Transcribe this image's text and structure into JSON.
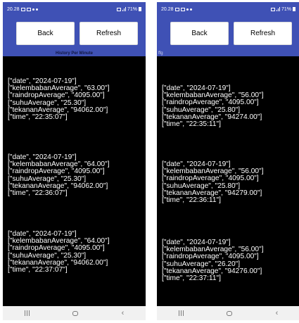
{
  "colors": {
    "app_bar": "#3f51b5",
    "content_bg": "#000000",
    "text": "#ffffff",
    "nav_bar": "#f1f1f1"
  },
  "icons": {
    "status_left": [
      "notification-icon",
      "notification-icon",
      "alarm-icon",
      "dot-icon"
    ],
    "status_right": [
      "vibrate-icon",
      "signal-icon",
      "battery-icon"
    ],
    "nav": [
      "recents-icon",
      "home-icon",
      "back-icon"
    ]
  },
  "screens": [
    {
      "status": {
        "time": "20.28",
        "battery": "71%"
      },
      "buttons": {
        "back": "Back",
        "refresh": "Refresh"
      },
      "caption": "History Per Minute",
      "records": [
        [
          "[\"date\", \"2024-07-19\"]",
          "[\"kelembabanAverage\", \"63.00\"]",
          "[\"raindropAverage\", \"4095.00\"]",
          "[\"suhuAverage\", \"25.30\"]",
          "[\"tekananAverage\", \"94062.00\"]",
          "[\"time\", \"22:35:07\"]"
        ],
        [
          "[\"date\", \"2024-07-19\"]",
          "[\"kelembabanAverage\", \"64.00\"]",
          "[\"raindropAverage\", \"4095.00\"]",
          "[\"suhuAverage\", \"25.30\"]",
          "[\"tekananAverage\", \"94062.00\"]",
          "[\"time\", \"22:36:07\"]"
        ],
        [
          "[\"date\", \"2024-07-19\"]",
          "[\"kelembabanAverage\", \"64.00\"]",
          "[\"raindropAverage\", \"4095.00\"]",
          "[\"suhuAverage\", \"25.30\"]",
          "[\"tekananAverage\", \"94062.00\"]",
          "[\"time\", \"22:37:07\"]"
        ]
      ]
    },
    {
      "status": {
        "time": "20.28",
        "battery": "71%"
      },
      "buttons": {
        "back": "Back",
        "refresh": "Refresh"
      },
      "caption": "ffg",
      "records": [
        [
          "[\"date\", \"2024-07-19\"]",
          "[\"kelembabanAverage\", \"56.00\"]",
          "[\"raindropAverage\", \"4095.00\"]",
          "[\"suhuAverage\", \"25.80\"]",
          "[\"tekananAverage\", \"94274.00\"]",
          "[\"time\", \"22:35:11\"]"
        ],
        [
          "[\"date\", \"2024-07-19\"]",
          "[\"kelembabanAverage\", \"56.00\"]",
          "[\"raindropAverage\", \"4095.00\"]",
          "[\"suhuAverage\", \"25.80\"]",
          "[\"tekananAverage\", \"94279.00\"]",
          "[\"time\", \"22:36:11\"]"
        ],
        [
          "[\"date\", \"2024-07-19\"]",
          "[\"kelembabanAverage\", \"56.00\"]",
          "[\"raindropAverage\", \"4095.00\"]",
          "[\"suhuAverage\", \"26.20\"]",
          "[\"tekananAverage\", \"94276.00\"]",
          "[\"time\", \"22:37:11\"]"
        ]
      ]
    }
  ]
}
